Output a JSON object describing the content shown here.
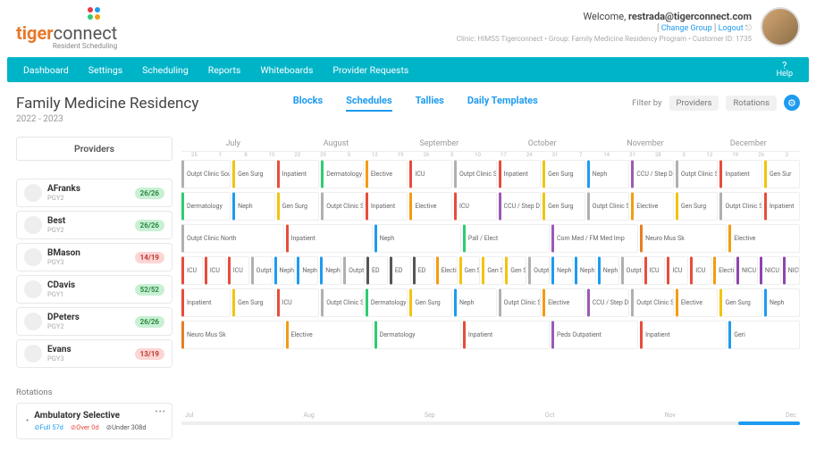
{
  "brand": {
    "part1": "tiger",
    "part2": "connect",
    "sub": "Resident Scheduling"
  },
  "user": {
    "welcome": "Welcome, ",
    "email": "restrada@tigerconnect.com",
    "change_group": "Change Group",
    "logout": "Logout",
    "clinic": "Clinic: HIMSS Tigerconnect • Group: Family Medicine Residency Program • Customer ID: 1735"
  },
  "nav": {
    "items": [
      "Dashboard",
      "Settings",
      "Scheduling",
      "Reports",
      "Whiteboards",
      "Provider Requests"
    ],
    "help": "Help"
  },
  "page": {
    "title": "Family Medicine Residency",
    "year": "2022 - 2023"
  },
  "tabs": {
    "items": [
      "Blocks",
      "Schedules",
      "Tallies",
      "Daily Templates"
    ],
    "active": 1
  },
  "filter": {
    "label": "Filter by",
    "b1": "Providers",
    "b2": "Rotations"
  },
  "months": [
    "July",
    "August",
    "September",
    "October",
    "November",
    "December"
  ],
  "day_ticks": [
    "25",
    "1",
    "8",
    "15",
    "22",
    "29",
    "5",
    "12",
    "19",
    "26",
    "3",
    "10",
    "17",
    "24",
    "31",
    "7",
    "14",
    "21",
    "28",
    "5",
    "12",
    "19",
    "26",
    "2"
  ],
  "providers_hdr": "Providers",
  "providers": [
    {
      "name": "AFranks",
      "pgy": "PGY2",
      "badge": "26/26",
      "bcls": "b-g"
    },
    {
      "name": "Best",
      "pgy": "PGY2",
      "badge": "26/26",
      "bcls": "b-g"
    },
    {
      "name": "BMason",
      "pgy": "PGY3",
      "badge": "14/19",
      "bcls": "b-r"
    },
    {
      "name": "CDavis",
      "pgy": "PGY1",
      "badge": "52/52",
      "bcls": "b-g"
    },
    {
      "name": "DPeters",
      "pgy": "PGY2",
      "badge": "26/26",
      "bcls": "b-g"
    },
    {
      "name": "Evans",
      "pgy": "PGY3",
      "badge": "13/19",
      "bcls": "b-r"
    }
  ],
  "rows": [
    [
      {
        "t": "Outpt Clinic South",
        "c": "#b0b0b0",
        "w": 6
      },
      {
        "t": "Gen Surg",
        "c": "#f1c40f",
        "w": 5
      },
      {
        "t": "Inpatient",
        "c": "#e74c3c",
        "w": 5
      },
      {
        "t": "Dermatology",
        "c": "#2ecc71",
        "w": 5
      },
      {
        "t": "Elective",
        "c": "#f39c12",
        "w": 5
      },
      {
        "t": "ICU",
        "c": "#e74c3c",
        "w": 5
      },
      {
        "t": "Outpt Clinic South",
        "c": "#b0b0b0",
        "w": 5
      },
      {
        "t": "Inpatient",
        "c": "#e74c3c",
        "w": 5
      },
      {
        "t": "Gen Surg",
        "c": "#f1c40f",
        "w": 5
      },
      {
        "t": "Neph",
        "c": "#1d9bf0",
        "w": 5
      },
      {
        "t": "CCU / Step Down",
        "c": "#9b59b6",
        "w": 5
      },
      {
        "t": "Outpt Clinic South",
        "c": "#b0b0b0",
        "w": 5
      },
      {
        "t": "Inpatient",
        "c": "#e74c3c",
        "w": 5
      },
      {
        "t": "Gen Sur",
        "c": "#f1c40f",
        "w": 4
      }
    ],
    [
      {
        "t": "Dermatology",
        "c": "#2ecc71",
        "w": 6
      },
      {
        "t": "Neph",
        "c": "#1d9bf0",
        "w": 5
      },
      {
        "t": "Gen Surg",
        "c": "#f1c40f",
        "w": 5
      },
      {
        "t": "Outpt Clinic South",
        "c": "#b0b0b0",
        "w": 5
      },
      {
        "t": "Inpatient",
        "c": "#e74c3c",
        "w": 5
      },
      {
        "t": "Elective",
        "c": "#f39c12",
        "w": 5
      },
      {
        "t": "ICU",
        "c": "#e74c3c",
        "w": 5
      },
      {
        "t": "CCU / Step Down",
        "c": "#9b59b6",
        "w": 5
      },
      {
        "t": "Gen Surg",
        "c": "#f1c40f",
        "w": 5
      },
      {
        "t": "Outpt Clinic South",
        "c": "#b0b0b0",
        "w": 5
      },
      {
        "t": "Elective",
        "c": "#f39c12",
        "w": 5
      },
      {
        "t": "Gen Surg",
        "c": "#f1c40f",
        "w": 5
      },
      {
        "t": "Outpt Clinic South",
        "c": "#b0b0b0",
        "w": 5
      },
      {
        "t": "Inpatient",
        "c": "#e74c3c",
        "w": 4
      }
    ],
    [
      {
        "t": "Outpt Clinic North",
        "c": "#b0b0b0",
        "w": 12
      },
      {
        "t": "Inpatient",
        "c": "#e74c3c",
        "w": 10
      },
      {
        "t": "Neph",
        "c": "#1d9bf0",
        "w": 10
      },
      {
        "t": "Pall / Elect",
        "c": "#2ecc71",
        "w": 10
      },
      {
        "t": "Com Med / FM Med Imp",
        "c": "#9b59b6",
        "w": 10
      },
      {
        "t": "Neuro Mus Sk",
        "c": "#e67e22",
        "w": 10
      },
      {
        "t": "Elective",
        "c": "#f39c12",
        "w": 8
      }
    ],
    [
      {
        "t": "ICU",
        "c": "#e74c3c",
        "w": 3
      },
      {
        "t": "ICU",
        "c": "#e74c3c",
        "w": 3
      },
      {
        "t": "ICU",
        "c": "#e74c3c",
        "w": 3
      },
      {
        "t": "Outpt",
        "c": "#b0b0b0",
        "w": 3
      },
      {
        "t": "Neph",
        "c": "#1d9bf0",
        "w": 3
      },
      {
        "t": "Neph",
        "c": "#1d9bf0",
        "w": 3
      },
      {
        "t": "Neph",
        "c": "#1d9bf0",
        "w": 3
      },
      {
        "t": "Outpt",
        "c": "#b0b0b0",
        "w": 3
      },
      {
        "t": "ED",
        "c": "#555",
        "w": 3
      },
      {
        "t": "ED",
        "c": "#555",
        "w": 3
      },
      {
        "t": "ED",
        "c": "#555",
        "w": 3
      },
      {
        "t": "Elective",
        "c": "#f39c12",
        "w": 3
      },
      {
        "t": "Gen S",
        "c": "#f1c40f",
        "w": 3
      },
      {
        "t": "Gen S",
        "c": "#f1c40f",
        "w": 3
      },
      {
        "t": "Gen S",
        "c": "#f1c40f",
        "w": 3
      },
      {
        "t": "Outpt",
        "c": "#b0b0b0",
        "w": 3
      },
      {
        "t": "Neph",
        "c": "#1d9bf0",
        "w": 3
      },
      {
        "t": "Neph",
        "c": "#1d9bf0",
        "w": 3
      },
      {
        "t": "Neph",
        "c": "#1d9bf0",
        "w": 3
      },
      {
        "t": "Outpt",
        "c": "#b0b0b0",
        "w": 3
      },
      {
        "t": "ICU",
        "c": "#e74c3c",
        "w": 3
      },
      {
        "t": "ICU",
        "c": "#e74c3c",
        "w": 3
      },
      {
        "t": "ICU",
        "c": "#e74c3c",
        "w": 3
      },
      {
        "t": "Elective",
        "c": "#f39c12",
        "w": 3
      },
      {
        "t": "NICU",
        "c": "#8e44ad",
        "w": 3
      },
      {
        "t": "NICU",
        "c": "#8e44ad",
        "w": 3
      },
      {
        "t": "NICU",
        "c": "#8e44ad",
        "w": 2
      }
    ],
    [
      {
        "t": "Inpatient",
        "c": "#e74c3c",
        "w": 6
      },
      {
        "t": "Gen Surg",
        "c": "#f1c40f",
        "w": 5
      },
      {
        "t": "ICU",
        "c": "#e74c3c",
        "w": 5
      },
      {
        "t": "Outpt Clinic South",
        "c": "#b0b0b0",
        "w": 5
      },
      {
        "t": "Dermatology",
        "c": "#2ecc71",
        "w": 5
      },
      {
        "t": "Gen Surg",
        "c": "#f1c40f",
        "w": 5
      },
      {
        "t": "Neph",
        "c": "#1d9bf0",
        "w": 5
      },
      {
        "t": "Outpt Clinic South",
        "c": "#b0b0b0",
        "w": 5
      },
      {
        "t": "Elective",
        "c": "#f39c12",
        "w": 5
      },
      {
        "t": "CCU / Step Down",
        "c": "#9b59b6",
        "w": 5
      },
      {
        "t": "Outpt Clinic South",
        "c": "#b0b0b0",
        "w": 5
      },
      {
        "t": "Elective",
        "c": "#f39c12",
        "w": 5
      },
      {
        "t": "Gen Surg",
        "c": "#f1c40f",
        "w": 5
      },
      {
        "t": "Neph",
        "c": "#1d9bf0",
        "w": 4
      }
    ],
    [
      {
        "t": "Neuro Mus Sk",
        "c": "#e67e22",
        "w": 12
      },
      {
        "t": "Elective",
        "c": "#f39c12",
        "w": 10
      },
      {
        "t": "Dermatology",
        "c": "#2ecc71",
        "w": 10
      },
      {
        "t": "Inpatient",
        "c": "#e74c3c",
        "w": 10
      },
      {
        "t": "Peds Outpatient",
        "c": "#9b59b6",
        "w": 10
      },
      {
        "t": "Inpatient",
        "c": "#e74c3c",
        "w": 10
      },
      {
        "t": "Geri",
        "c": "#1d9bf0",
        "w": 8
      }
    ]
  ],
  "rotations": {
    "label": "Rotations",
    "card": {
      "dot": "•",
      "name": "Ambulatory Selective",
      "full": "Full 57d",
      "over": "Over 0d",
      "under": "Under 308d",
      "dots": "•••"
    },
    "tl": [
      "Jul",
      "Aug",
      "Sep",
      "Oct",
      "Nov",
      "Dec"
    ]
  }
}
